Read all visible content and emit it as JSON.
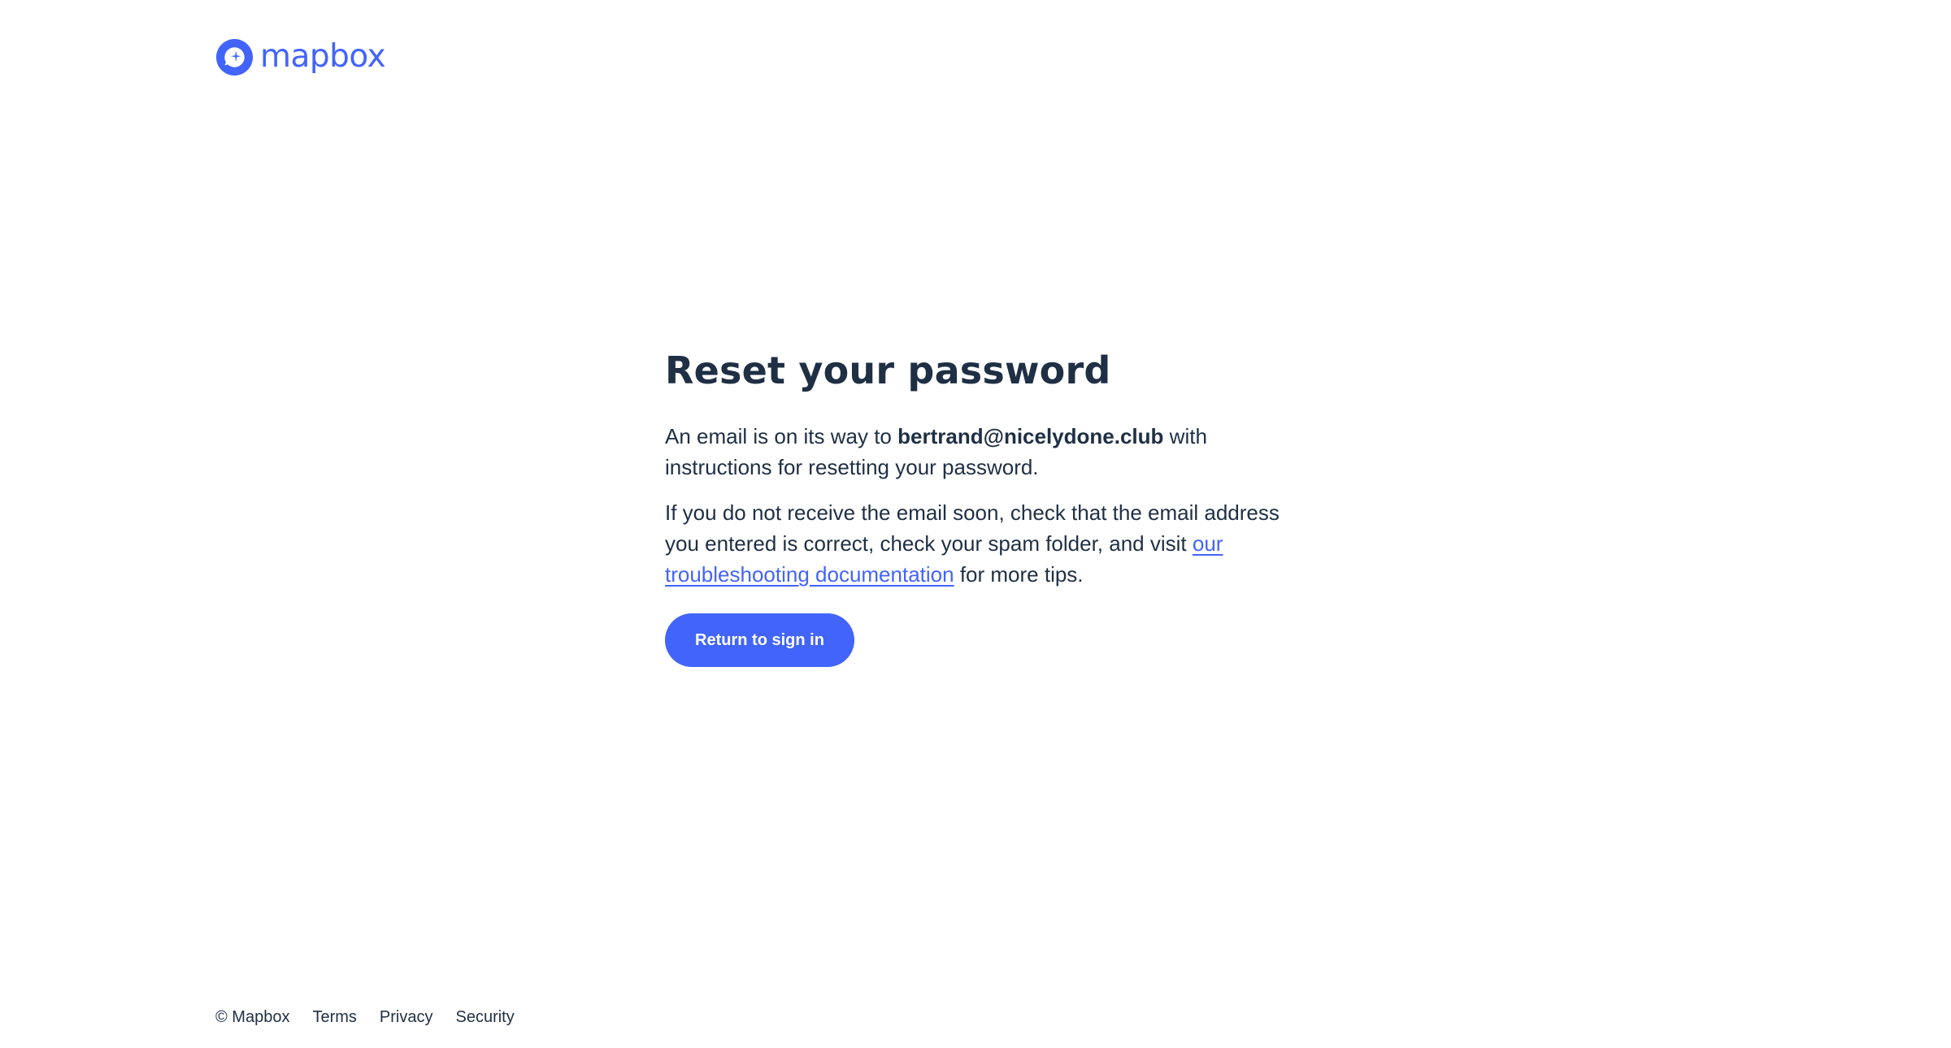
{
  "brand": {
    "name": "mapbox",
    "color": "#4264fb"
  },
  "main": {
    "title": "Reset your password",
    "message": {
      "prefix": "An email is on its way to ",
      "email": "bertrand@nicelydone.club",
      "suffix": " with instructions for resetting your password."
    },
    "help": {
      "prefix": "If you do not receive the email soon, check that the email address you entered is correct, check your spam folder, and visit ",
      "link_text": "our troubleshooting documentation",
      "suffix": " for more tips."
    },
    "button_label": "Return to sign in"
  },
  "footer": {
    "copyright": "© Mapbox",
    "links": [
      "Terms",
      "Privacy",
      "Security"
    ]
  },
  "colors": {
    "accent": "#4264fb",
    "text": "#1f2f44",
    "background": "#ffffff"
  },
  "icons": {
    "logo": "mapbox-logo-icon"
  }
}
